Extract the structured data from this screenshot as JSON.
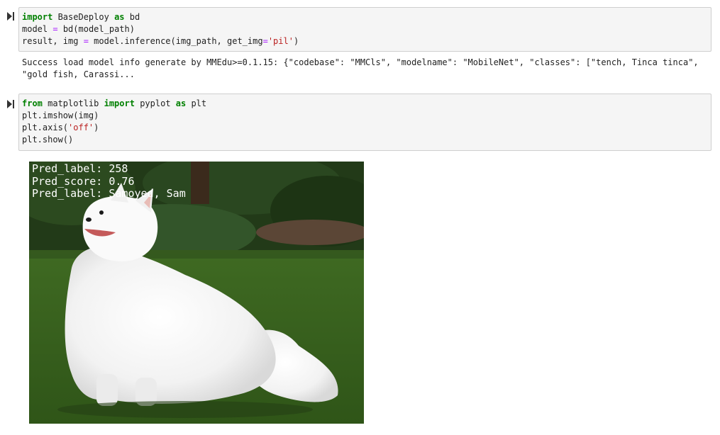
{
  "cells": [
    {
      "lines": [
        [
          {
            "t": "import",
            "c": "kw"
          },
          {
            "t": " BaseDeploy "
          },
          {
            "t": "as",
            "c": "kw"
          },
          {
            "t": " bd"
          }
        ],
        [
          {
            "t": "model "
          },
          {
            "t": "=",
            "c": "op"
          },
          {
            "t": " bd(model_path)"
          }
        ],
        [
          {
            "t": "result, img "
          },
          {
            "t": "=",
            "c": "op"
          },
          {
            "t": " model.inference(img_path, get_img"
          },
          {
            "t": "=",
            "c": "op"
          },
          {
            "t": "'pil'",
            "c": "str"
          },
          {
            "t": ")"
          }
        ]
      ],
      "output": "Success load model info generate by MMEdu>=0.1.15: {\"codebase\": \"MMCls\", \"modelname\": \"MobileNet\", \"classes\": [\"tench, Tinca tinca\", \"gold fish, Carassi..."
    },
    {
      "lines": [
        [
          {
            "t": "from",
            "c": "kw"
          },
          {
            "t": " matplotlib "
          },
          {
            "t": "import",
            "c": "kw"
          },
          {
            "t": " pyplot "
          },
          {
            "t": "as",
            "c": "kw"
          },
          {
            "t": " plt"
          }
        ],
        [
          {
            "t": "plt.imshow(img)"
          }
        ],
        [
          {
            "t": "plt.axis("
          },
          {
            "t": "'off'",
            "c": "str"
          },
          {
            "t": ")"
          }
        ],
        [
          {
            "t": "plt.show()"
          }
        ]
      ]
    }
  ],
  "figure": {
    "labels": [
      "Pred_label: 258",
      "Pred_score: 0.76",
      "Pred_label: Samoyed, Sam"
    ]
  }
}
